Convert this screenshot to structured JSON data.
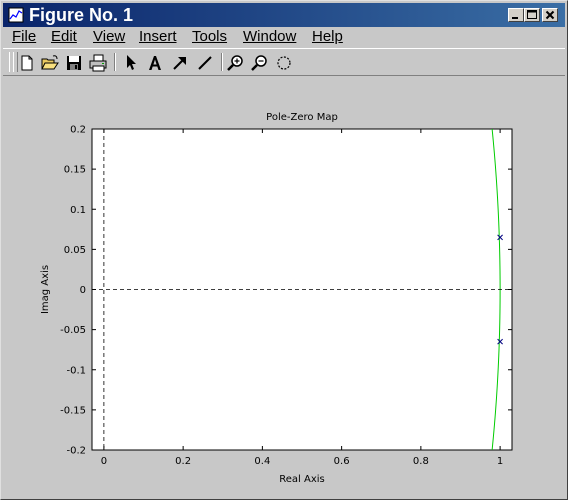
{
  "window": {
    "title": "Figure No. 1"
  },
  "menu": [
    {
      "label": "File",
      "accel_index": 0
    },
    {
      "label": "Edit",
      "accel_index": 0
    },
    {
      "label": "View",
      "accel_index": 0
    },
    {
      "label": "Insert",
      "accel_index": 0
    },
    {
      "label": "Tools",
      "accel_index": 0
    },
    {
      "label": "Window",
      "accel_index": 0
    },
    {
      "label": "Help",
      "accel_index": 0
    }
  ],
  "toolbar": [
    {
      "name": "new-figure-button",
      "icon": "new-file-icon"
    },
    {
      "name": "open-button",
      "icon": "folder-open-icon"
    },
    {
      "name": "save-button",
      "icon": "floppy-disk-icon"
    },
    {
      "name": "print-button",
      "icon": "printer-icon"
    },
    {
      "name": "edit-plot-button",
      "icon": "arrow-cursor-icon"
    },
    {
      "name": "insert-text-button",
      "icon": "text-a-icon"
    },
    {
      "name": "insert-arrow-button",
      "icon": "diagonal-arrow-icon"
    },
    {
      "name": "insert-line-button",
      "icon": "diagonal-line-icon"
    },
    {
      "name": "zoom-in-button",
      "icon": "zoom-in-icon"
    },
    {
      "name": "zoom-out-button",
      "icon": "zoom-out-icon"
    },
    {
      "name": "rotate-3d-button",
      "icon": "rotate-icon"
    }
  ],
  "chart_data": {
    "type": "scatter",
    "title": "Pole-Zero Map",
    "xlabel": "Real Axis",
    "ylabel": "Imag Axis",
    "xlim": [
      -0.03,
      1.03
    ],
    "ylim": [
      -0.2,
      0.2
    ],
    "xticks": [
      "0",
      "0.2",
      "0.4",
      "0.6",
      "0.8",
      "1"
    ],
    "xtick_values": [
      0,
      0.2,
      0.4,
      0.6,
      0.8,
      1
    ],
    "yticks": [
      "0.2",
      "0.15",
      "0.1",
      "0.05",
      "0",
      "-0.05",
      "-0.1",
      "-0.15",
      "-0.2"
    ],
    "ytick_values": [
      0.2,
      0.15,
      0.1,
      0.05,
      0,
      -0.05,
      -0.1,
      -0.15,
      -0.2
    ],
    "grid": false,
    "poles": [
      {
        "real": 1.0,
        "imag": 0.065
      },
      {
        "real": 1.0,
        "imag": -0.065
      }
    ],
    "unit_circle_color": "#00cc00",
    "marker_color": "#000080",
    "dashed_axes_color": "#000000"
  }
}
